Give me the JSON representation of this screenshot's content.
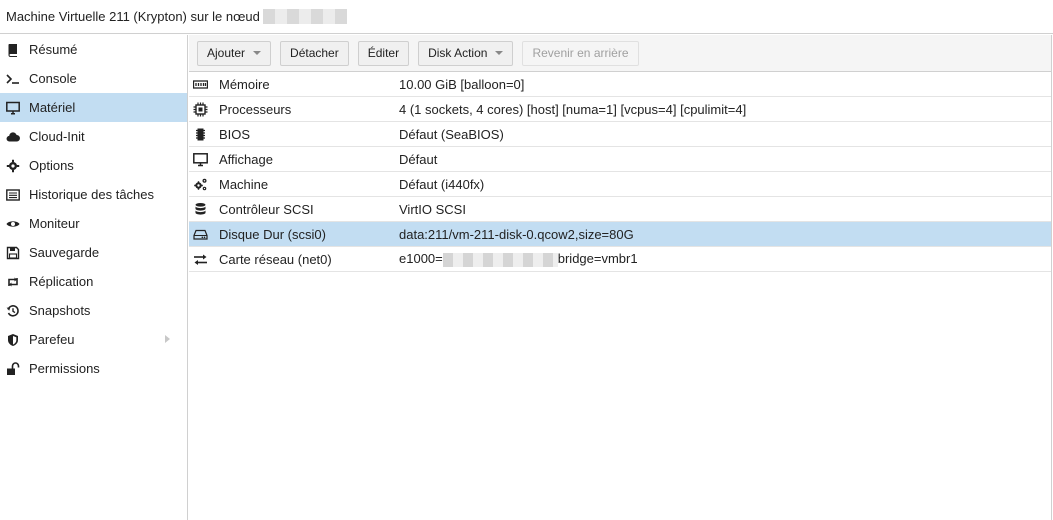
{
  "window": {
    "title": "Machine Virtuelle 211 (Krypton) sur le nœud"
  },
  "sidebar": {
    "items": [
      {
        "label": "Résumé",
        "icon": "book-icon"
      },
      {
        "label": "Console",
        "icon": "terminal-icon"
      },
      {
        "label": "Matériel",
        "icon": "desktop-icon",
        "active": true
      },
      {
        "label": "Cloud-Init",
        "icon": "cloud-icon"
      },
      {
        "label": "Options",
        "icon": "gear-icon"
      },
      {
        "label": "Historique des tâches",
        "icon": "list-icon"
      },
      {
        "label": "Moniteur",
        "icon": "eye-icon"
      },
      {
        "label": "Sauvegarde",
        "icon": "floppy-icon"
      },
      {
        "label": "Réplication",
        "icon": "retweet-icon"
      },
      {
        "label": "Snapshots",
        "icon": "history-icon"
      },
      {
        "label": "Parefeu",
        "icon": "shield-icon",
        "expandable": true
      },
      {
        "label": "Permissions",
        "icon": "unlock-icon"
      }
    ]
  },
  "toolbar": {
    "add": "Ajouter",
    "detach": "Détacher",
    "edit": "Éditer",
    "disk_action": "Disk Action",
    "revert": "Revenir en arrière"
  },
  "hardware": {
    "rows": [
      {
        "key": "Mémoire",
        "value": "10.00 GiB [balloon=0]",
        "icon": "memory-icon"
      },
      {
        "key": "Processeurs",
        "value": "4 (1 sockets, 4 cores) [host] [numa=1] [vcpus=4] [cpulimit=4]",
        "icon": "cpu-icon"
      },
      {
        "key": "BIOS",
        "value": "Défaut (SeaBIOS)",
        "icon": "microchip-icon"
      },
      {
        "key": "Affichage",
        "value": "Défaut",
        "icon": "desktop-icon"
      },
      {
        "key": "Machine",
        "value": "Défaut (i440fx)",
        "icon": "cogs-icon"
      },
      {
        "key": "Contrôleur SCSI",
        "value": "VirtIO SCSI",
        "icon": "database-icon"
      },
      {
        "key": "Disque Dur (scsi0)",
        "value": "data:211/vm-211-disk-0.qcow2,size=80G",
        "icon": "hdd-icon",
        "selected": true
      },
      {
        "key": "Carte réseau (net0)",
        "value_prefix": "e1000=",
        "value_suffix": "bridge=vmbr1",
        "icon": "exchange-icon"
      }
    ]
  }
}
